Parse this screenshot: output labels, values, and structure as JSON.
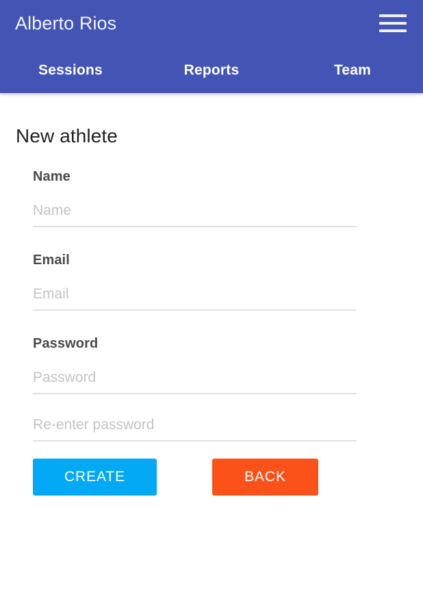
{
  "theme": {
    "appbar_color": "#4354b5",
    "appbar_text_color": "#ffffff",
    "page_background": "#ffffff",
    "label_color": "#4a4a4a",
    "placeholder_color": "#c4c4c4",
    "input_underline_color": "#e0e0e0",
    "create_button_color": "#03a9f4",
    "back_button_color": "#fa5219"
  },
  "header": {
    "title": "Alberto Rios",
    "menu_icon": "hamburger-menu-icon",
    "tabs": [
      {
        "label": "Sessions"
      },
      {
        "label": "Reports"
      },
      {
        "label": "Team"
      }
    ]
  },
  "main": {
    "page_title": "New athlete",
    "fields": [
      {
        "label": "Name",
        "placeholder": "Name",
        "value": "",
        "type": "text"
      },
      {
        "label": "Email",
        "placeholder": "Email",
        "value": "",
        "type": "email"
      },
      {
        "label": "Password",
        "placeholder": "Password",
        "value": "",
        "type": "password"
      },
      {
        "label": "",
        "placeholder": "Re-enter password",
        "value": "",
        "type": "password"
      }
    ],
    "buttons": {
      "create_label": "CREATE",
      "back_label": "BACK"
    }
  }
}
